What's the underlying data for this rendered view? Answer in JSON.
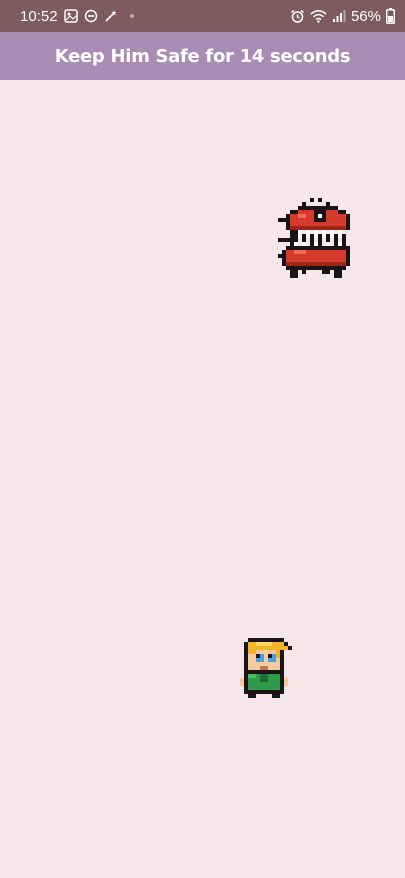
{
  "status_bar": {
    "time": "10:52",
    "battery": "56%",
    "left_icons": [
      "gallery-icon",
      "do-not-disturb-icon",
      "magic-wand-icon"
    ],
    "right_icons": [
      "alarm-icon",
      "wifi-icon",
      "signal-icon",
      "battery-icon"
    ]
  },
  "app_bar": {
    "title": "Keep Him Safe for 14 seconds",
    "color": "#A98CB3"
  },
  "game": {
    "background_color": "#F5E6EA",
    "sprites": [
      "red-monster",
      "blond-boy-hero"
    ]
  }
}
